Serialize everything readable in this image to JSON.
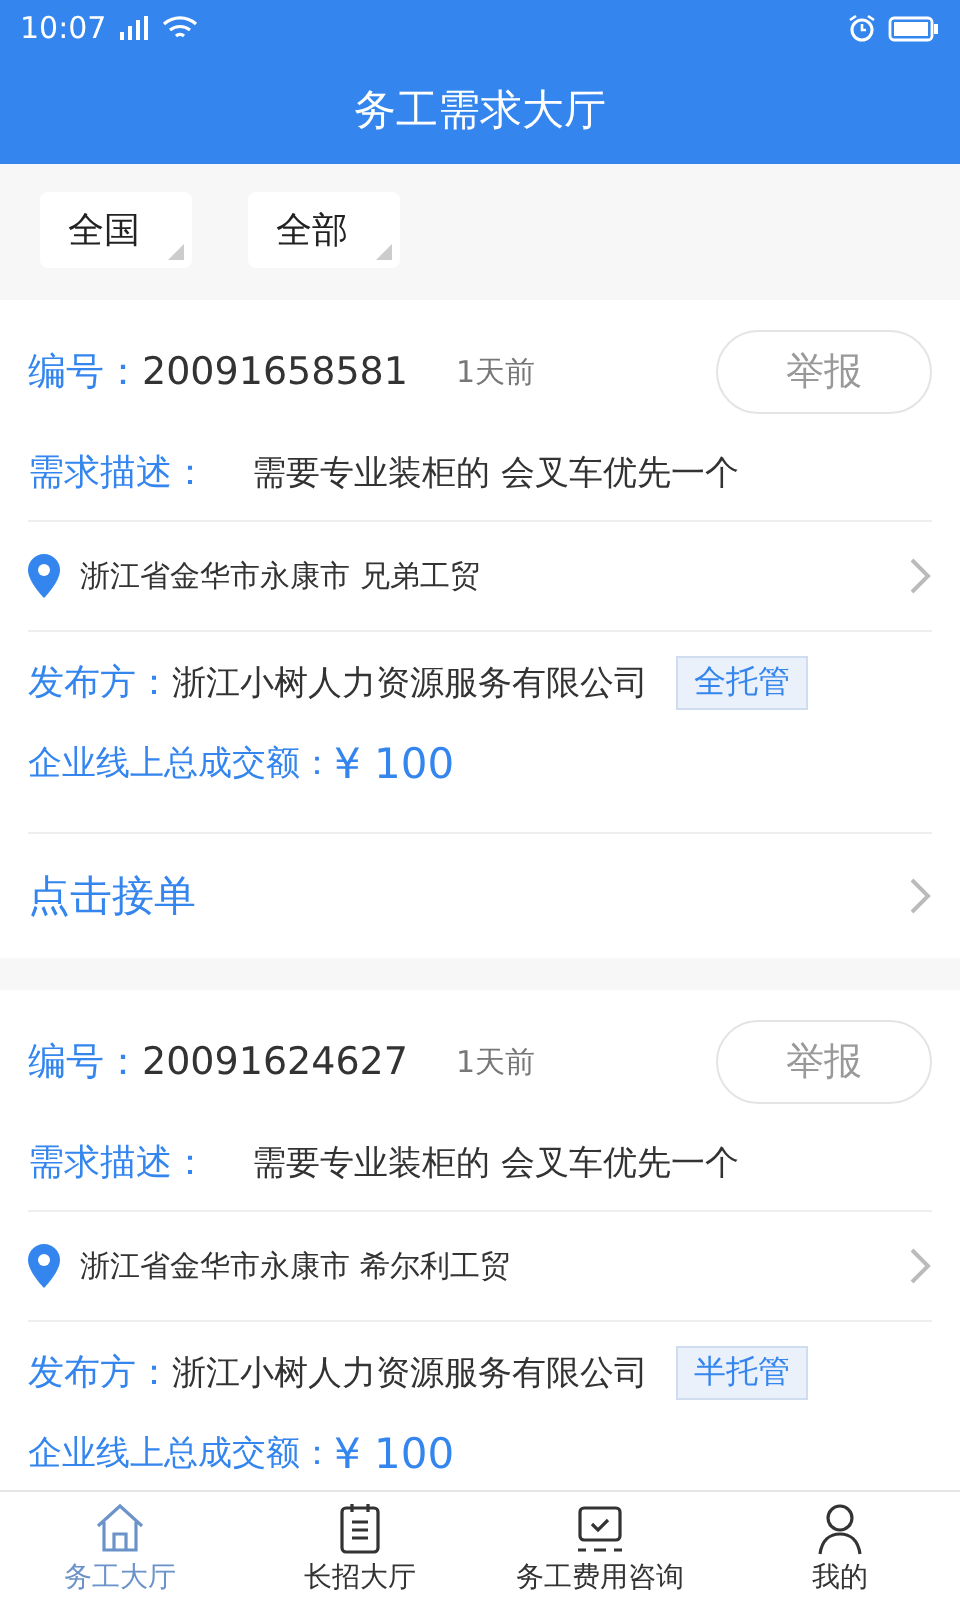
{
  "status_bar": {
    "time": "10:07"
  },
  "header": {
    "title": "务工需求大厅"
  },
  "filters": [
    {
      "label": "全国"
    },
    {
      "label": "全部"
    }
  ],
  "cards": [
    {
      "id_label": "编号：",
      "id": "20091658581",
      "time": "1天前",
      "report": "举报",
      "desc_label": "需求描述：",
      "desc": "需要专业装柜的 会叉车优先一个",
      "location": "浙江省金华市永康市 兄弟工贸",
      "publisher_label": "发布方：",
      "publisher": "浙江小树人力资源服务有限公司",
      "tag": "全托管",
      "amount_label": "企业线上总成交额：",
      "amount": "¥ 100",
      "action": "点击接单"
    },
    {
      "id_label": "编号：",
      "id": "20091624627",
      "time": "1天前",
      "report": "举报",
      "desc_label": "需求描述：",
      "desc": "需要专业装柜的 会叉车优先一个",
      "location": "浙江省金华市永康市 希尔利工贸",
      "publisher_label": "发布方：",
      "publisher": "浙江小树人力资源服务有限公司",
      "tag": "半托管",
      "amount_label": "企业线上总成交额：",
      "amount": "¥ 100"
    }
  ],
  "tab_bar": [
    {
      "label": "务工大厅",
      "selected": true
    },
    {
      "label": "长招大厅",
      "selected": false
    },
    {
      "label": "务工费用咨询",
      "selected": false
    },
    {
      "label": "我的",
      "selected": false
    }
  ]
}
